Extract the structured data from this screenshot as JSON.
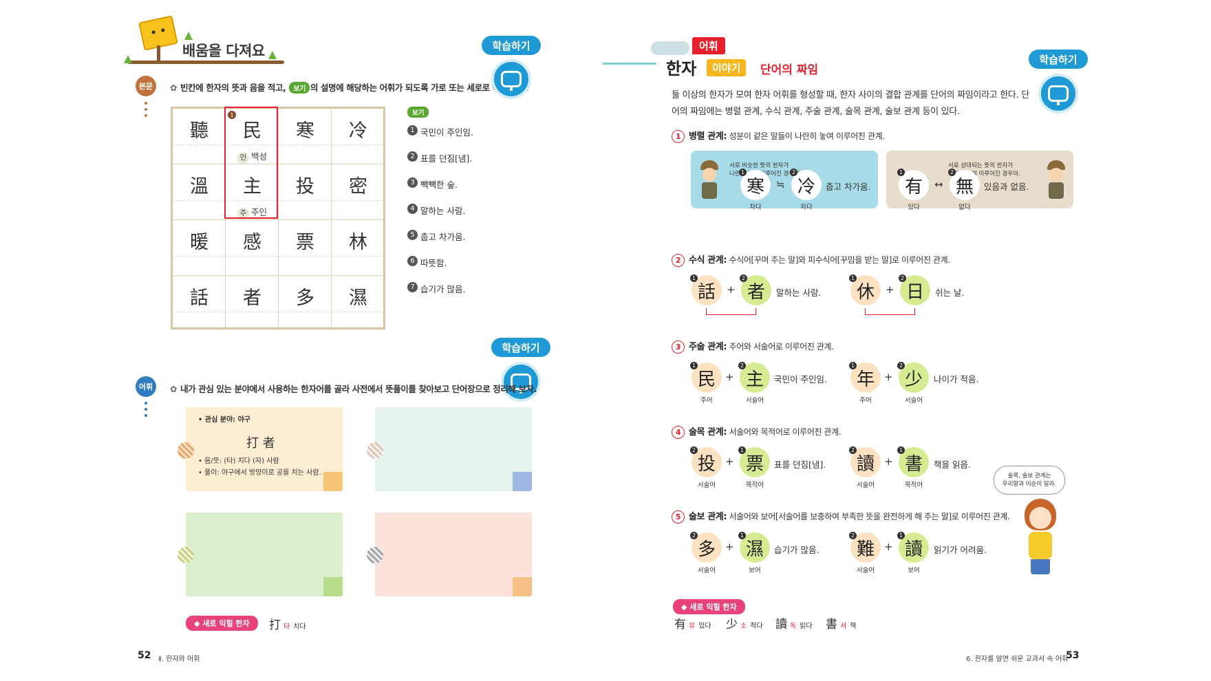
{
  "left": {
    "stage_title": "배움을 다져요",
    "section1": {
      "badge": "본문",
      "instruction_pre": "빈칸에 한자의 뜻과 음을 적고,",
      "bogi_pill": "보기",
      "instruction_post": "의 설명에 해당하는 어휘가 되도록 가로 또는 세로로 묶어 보자.",
      "learn_label": "학습하기",
      "grid": [
        [
          "聽",
          "民",
          "寒",
          "冷"
        ],
        [
          "溫",
          "主",
          "投",
          "密"
        ],
        [
          "暖",
          "感",
          "票",
          "林"
        ],
        [
          "話",
          "者",
          "多",
          "濕"
        ]
      ],
      "grid_num": "1",
      "reading_min_circ": "민",
      "reading_min_text": "백성",
      "reading_ju_circ": "주",
      "reading_ju_text": "주인",
      "bogi_tag": "보기",
      "bogi_items": [
        {
          "n": "1",
          "t": "국민이 주인임."
        },
        {
          "n": "2",
          "t": "표를 던짐[냄]."
        },
        {
          "n": "3",
          "t": "빽빽한 숲."
        },
        {
          "n": "4",
          "t": "말하는 사람."
        },
        {
          "n": "5",
          "t": "춥고 차가움."
        },
        {
          "n": "6",
          "t": "따뜻함."
        },
        {
          "n": "7",
          "t": "습기가 많음."
        }
      ]
    },
    "section2": {
      "badge": "어휘",
      "instruction": "내가 관심 있는 분야에서 사용하는 한자어를 골라 사전에서 뜻풀이를 찾아보고 단어장으로 정리해 보자.",
      "learn_label": "학습하기",
      "card": {
        "field": "• 관심 분야: 야구",
        "word": "打 者",
        "reading": "• 음/뜻: (타) 치다  (자) 사람",
        "meaning": "• 풀이: 야구에서 방망이로 공을 치는 사람."
      }
    },
    "new_hanja_tag": "◆ 새로 익힐 한자",
    "new_hanja": {
      "ch": "打",
      "rd": "타",
      "mn": "치다"
    },
    "page_number": "52",
    "page_sub": "Ⅱ. 한자와 어휘"
  },
  "right": {
    "vocab_tag": "어휘",
    "title_main": "한자",
    "title_tag": "이야기",
    "subtitle": "단어의 짜임",
    "learn_label": "학습하기",
    "intro": "둘 이상의 한자가 모여 한자 어휘를 형성할 때, 한자 사이의 결합 관계를 단어의 짜임이라고 한다. 단어의 짜임에는 병렬 관계, 수식 관계, 주술 관계, 술목 관계, 술보 관계 등이 있다.",
    "sections": [
      {
        "num": "1",
        "name": "병렬 관계:",
        "desc": " 성분이 같은 말들이 나란히 놓여 이루어진 관계."
      },
      {
        "num": "2",
        "name": "수식 관계:",
        "desc": " 수식어[꾸며 주는 말]와 피수식어[꾸밈을 받는 말]로 이루어진 관계."
      },
      {
        "num": "3",
        "name": "주술 관계:",
        "desc": " 주어와 서술어로 이루어진 관계."
      },
      {
        "num": "4",
        "name": "술목 관계:",
        "desc": " 서술어와 목적어로 이루어진 관계."
      },
      {
        "num": "5",
        "name": "술보 관계:",
        "desc": " 서술어와 보어[서술어를 보충하여 부족한 뜻을 완전하게 해 주는 말]로 이루어진 관계."
      }
    ],
    "parallel": {
      "blue": {
        "bubble1": "서로 비슷한 뜻의 한자가",
        "bubble2": "나란히 놓여 이루어진 경우야.",
        "c1": "寒",
        "c2": "冷",
        "sym": "≒",
        "mean": "춥고 차가움.",
        "l1": "차다",
        "l2": "차다",
        "n1": "1",
        "n2": "2"
      },
      "tan": {
        "bubble1": "서로 상대되는 뜻의 한자가",
        "bubble2": "나란히 놓여 이루어진 경우야.",
        "c1": "有",
        "c2": "無",
        "sym": "↔",
        "mean": "있음과 없음.",
        "l1": "있다",
        "l2": "없다",
        "n1": "1",
        "n2": "2"
      }
    },
    "modifier": [
      {
        "c1": "話",
        "c2": "者",
        "mean": "말하는 사람.",
        "n1": "1",
        "n2": "2"
      },
      {
        "c1": "休",
        "c2": "日",
        "mean": "쉬는 날.",
        "n1": "1",
        "n2": "2"
      }
    ],
    "subject": [
      {
        "c1": "民",
        "c2": "主",
        "mean": "국민이 주인임.",
        "r1": "주어",
        "r2": "서술어",
        "n1": "1",
        "n2": "2"
      },
      {
        "c1": "年",
        "c2": "少",
        "mean": "나이가 적음.",
        "r1": "주어",
        "r2": "서술어",
        "n1": "1",
        "n2": "2"
      }
    ],
    "object": [
      {
        "c1": "投",
        "c2": "票",
        "mean": "표를 던짐[냄].",
        "r1": "서술어",
        "r2": "목적어",
        "n1": "2",
        "n2": "1"
      },
      {
        "c1": "讀",
        "c2": "書",
        "mean": "책을 읽음.",
        "r1": "서술어",
        "r2": "목적어",
        "n1": "2",
        "n2": "1"
      }
    ],
    "complement": [
      {
        "c1": "多",
        "c2": "濕",
        "mean": "습기가 많음.",
        "r1": "서술어",
        "r2": "보어",
        "n1": "2",
        "n2": "1"
      },
      {
        "c1": "難",
        "c2": "讀",
        "mean": "읽기가 어려움.",
        "r1": "서술어",
        "r2": "보어",
        "n1": "2",
        "n2": "1"
      }
    ],
    "plus": "+",
    "speech1": "술목, 술보 관계는",
    "speech2": "우리말과 어순이 달라.",
    "new_hanja_tag": "◆ 새로 익힐 한자",
    "new_hanja": [
      {
        "ch": "有",
        "rd": "유",
        "mn": "있다"
      },
      {
        "ch": "少",
        "rd": "소",
        "mn": "적다"
      },
      {
        "ch": "讀",
        "rd": "독",
        "mn": "읽다"
      },
      {
        "ch": "書",
        "rd": "서",
        "mn": "책"
      }
    ],
    "page_number": "53",
    "page_sub": "6. 한자를 알면 쉬운 교과서 속 어휘"
  }
}
